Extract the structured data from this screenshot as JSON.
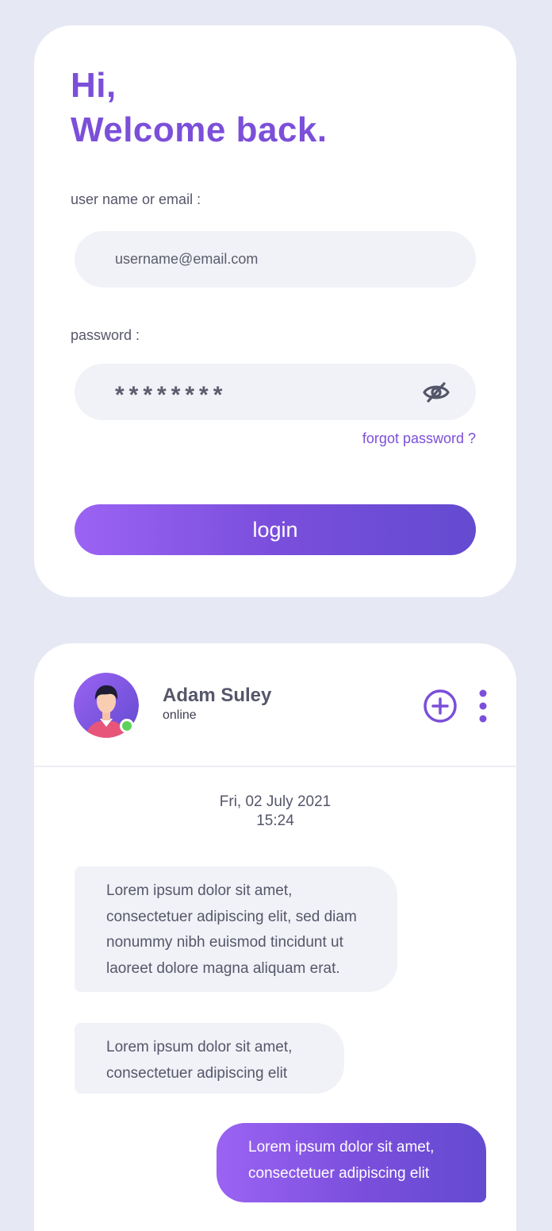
{
  "login": {
    "greeting_line1": "Hi,",
    "greeting_line2": "Welcome back.",
    "username_label": "user name or email :",
    "username_placeholder": "username@email.com",
    "password_label": "password :",
    "password_mask": "********",
    "forgot_password": "forgot password ?",
    "login_button": "login"
  },
  "chat": {
    "contact_name": "Adam Suley",
    "contact_status": "online",
    "date": "Fri, 02 July 2021",
    "time": "15:24",
    "messages": [
      {
        "direction": "incoming",
        "text": "Lorem ipsum dolor sit amet, consectetuer adipiscing elit, sed diam nonummy nibh euismod tincidunt ut laoreet dolore magna aliquam erat."
      },
      {
        "direction": "incoming",
        "text": "Lorem ipsum dolor sit amet, consectetuer adipiscing elit"
      },
      {
        "direction": "outgoing",
        "text": "Lorem ipsum dolor sit amet, consectetuer adipiscing elit"
      }
    ]
  },
  "icons": {
    "password_toggle": "eye-off-icon",
    "add": "plus-circle-icon",
    "more": "more-vertical-icon",
    "avatar": "user-avatar"
  },
  "colors": {
    "accent": "#7b4fd9",
    "background": "#e6e8f4",
    "input_bg": "#f1f2f7",
    "online": "#5cd25c"
  }
}
